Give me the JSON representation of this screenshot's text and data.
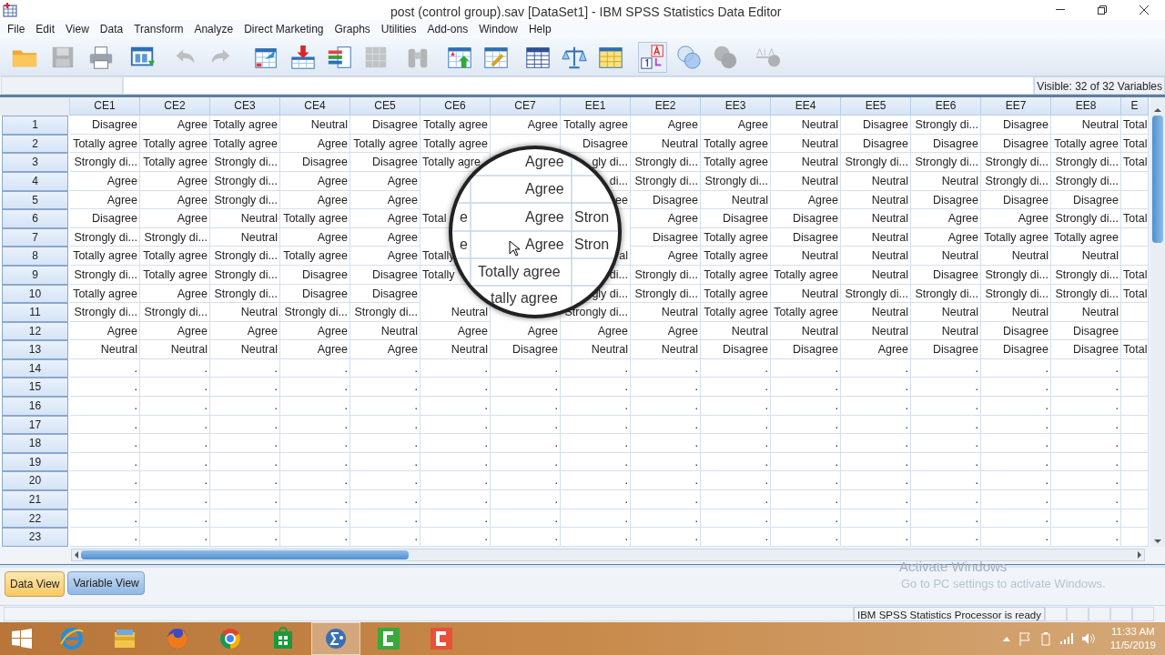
{
  "window": {
    "title": "post (control group).sav [DataSet1] - IBM SPSS Statistics Data Editor"
  },
  "menu": [
    "File",
    "Edit",
    "View",
    "Data",
    "Transform",
    "Analyze",
    "Direct Marketing",
    "Graphs",
    "Utilities",
    "Add-ons",
    "Window",
    "Help"
  ],
  "toolbar": [
    {
      "kind": "folder",
      "disabled": false
    },
    {
      "kind": "disk",
      "disabled": true
    },
    {
      "kind": "printer",
      "disabled": false
    },
    {
      "kind": "recall",
      "disabled": false
    },
    {
      "kind": "undo",
      "disabled": true
    },
    {
      "kind": "redo",
      "disabled": true
    },
    {
      "kind": "goto-case",
      "disabled": false
    },
    {
      "kind": "goto-variable",
      "disabled": false
    },
    {
      "kind": "variables",
      "disabled": false
    },
    {
      "kind": "stats",
      "disabled": true
    },
    {
      "kind": "binoculars",
      "disabled": true
    },
    {
      "kind": "insert-case",
      "disabled": false
    },
    {
      "kind": "insert-variable",
      "disabled": false
    },
    {
      "kind": "split",
      "disabled": false
    },
    {
      "kind": "scale",
      "disabled": false
    },
    {
      "kind": "select",
      "disabled": false
    },
    {
      "kind": "value-labels",
      "disabled": false
    },
    {
      "kind": "sets",
      "disabled": false
    },
    {
      "kind": "sets-all",
      "disabled": true
    },
    {
      "kind": "spell",
      "disabled": true
    }
  ],
  "visible_variables": "Visible: 32 of 32 Variables",
  "table": {
    "columns": [
      "CE1",
      "CE2",
      "CE3",
      "CE4",
      "CE5",
      "CE6",
      "CE7",
      "EE1",
      "EE2",
      "EE3",
      "EE4",
      "EE5",
      "EE6",
      "EE7",
      "EE8",
      "E"
    ],
    "rows": [
      {
        "number": "1",
        "cells": [
          "Disagree",
          "Agree",
          "Totally agree",
          "Neutral",
          "Disagree",
          "Totally agree",
          "Agree",
          "Totally agree",
          "Agree",
          "Agree",
          "Neutral",
          "Disagree",
          "Strongly di...",
          "Disagree",
          "Neutral",
          "Total"
        ]
      },
      {
        "number": "2",
        "cells": [
          "Totally agree",
          "Totally agree",
          "Totally agree",
          "Agree",
          "Totally agree",
          "Totally agree",
          null,
          "Disagree",
          "Neutral",
          "Totally agree",
          "Neutral",
          "Disagree",
          "Disagree",
          "Disagree",
          "Totally agree",
          "Total"
        ]
      },
      {
        "number": "3",
        "cells": [
          "Strongly di...",
          "Totally agree",
          "Strongly di...",
          "Disagree",
          "Disagree",
          {
            "text": "Totally agre",
            "cut": true
          },
          null,
          "gly di...",
          "Strongly di...",
          "Totally agree",
          "Neutral",
          "Strongly di...",
          "Strongly di...",
          "Strongly di...",
          "Strongly di...",
          "Total"
        ]
      },
      {
        "number": "4",
        "cells": [
          "Agree",
          "Agree",
          "Strongly di...",
          "Agree",
          "Agree",
          null,
          null,
          "di...",
          "Strongly di...",
          "Strongly di...",
          "Neutral",
          "Neutral",
          "Neutral",
          "Strongly di...",
          "Strongly di...",
          null
        ]
      },
      {
        "number": "5",
        "cells": [
          "Agree",
          "Agree",
          "Strongly di...",
          "Agree",
          "Agree",
          null,
          null,
          "ee",
          "Disagree",
          "Neutral",
          "Agree",
          "Neutral",
          "Disagree",
          "Disagree",
          "Disagree",
          null
        ]
      },
      {
        "number": "6",
        "cells": [
          "Disagree",
          "Agree",
          "Neutral",
          "Totally agree",
          "Agree",
          {
            "text": "Total",
            "cut": true
          },
          null,
          null,
          "Agree",
          "Disagree",
          "Disagree",
          "Neutral",
          "Agree",
          "Agree",
          "Strongly di...",
          "Total"
        ]
      },
      {
        "number": "7",
        "cells": [
          "Strongly di...",
          "Strongly di...",
          "Neutral",
          "Agree",
          "Agree",
          null,
          null,
          null,
          "Disagree",
          "Totally agree",
          "Disagree",
          "Neutral",
          "Agree",
          "Totally agree",
          "Totally agree",
          null
        ]
      },
      {
        "number": "8",
        "cells": [
          "Totally agree",
          "Totally agree",
          "Strongly di...",
          "Totally agree",
          "Agree",
          {
            "text": "Totally",
            "cut": true
          },
          null,
          "al",
          "Agree",
          "Totally agree",
          "Neutral",
          "Neutral",
          "Neutral",
          "Neutral",
          "Neutral",
          null
        ]
      },
      {
        "number": "9",
        "cells": [
          "Strongly di...",
          "Totally agree",
          "Strongly di...",
          "Disagree",
          "Disagree",
          {
            "text": "Totally",
            "cut": true
          },
          null,
          "di...",
          "Strongly di...",
          "Totally agree",
          "Totally agree",
          "Neutral",
          "Disagree",
          "Strongly di...",
          "Strongly di...",
          "Total"
        ]
      },
      {
        "number": "10",
        "cells": [
          "Totally agree",
          "Agree",
          "Strongly di...",
          "Disagree",
          "Disagree",
          null,
          null,
          "gly di...",
          "Strongly di...",
          "Totally agree",
          "Neutral",
          "Strongly di...",
          "Strongly di...",
          "Strongly di...",
          "Strongly di...",
          "Total"
        ]
      },
      {
        "number": "11",
        "cells": [
          "Strongly di...",
          "Strongly di...",
          "Neutral",
          "Strongly di...",
          "Strongly di...",
          "Neutral",
          null,
          "Strongly di...",
          "Neutral",
          "Totally agree",
          "Totally agree",
          "Neutral",
          "Neutral",
          "Neutral",
          "Neutral",
          null
        ]
      },
      {
        "number": "12",
        "cells": [
          "Agree",
          "Agree",
          "Agree",
          "Agree",
          "Neutral",
          "Agree",
          "Agree",
          "Agree",
          "Agree",
          "Neutral",
          "Neutral",
          "Neutral",
          "Neutral",
          "Disagree",
          "Disagree",
          null
        ]
      },
      {
        "number": "13",
        "cells": [
          "Neutral",
          "Neutral",
          "Neutral",
          "Agree",
          "Agree",
          "Neutral",
          "Disagree",
          "Neutral",
          "Neutral",
          "Disagree",
          "Disagree",
          "Agree",
          "Disagree",
          "Disagree",
          "Disagree",
          "Total"
        ]
      },
      {
        "number": "14",
        "cells": [
          ".",
          ".",
          ".",
          ".",
          ".",
          ".",
          ".",
          ".",
          ".",
          ".",
          ".",
          ".",
          ".",
          ".",
          ".",
          null
        ]
      },
      {
        "number": "15",
        "cells": [
          ".",
          ".",
          ".",
          ".",
          ".",
          ".",
          ".",
          ".",
          ".",
          ".",
          ".",
          ".",
          ".",
          ".",
          ".",
          null
        ]
      },
      {
        "number": "16",
        "cells": [
          ".",
          ".",
          ".",
          ".",
          ".",
          ".",
          ".",
          ".",
          ".",
          ".",
          ".",
          ".",
          ".",
          ".",
          ".",
          null
        ]
      },
      {
        "number": "17",
        "cells": [
          ".",
          ".",
          ".",
          ".",
          ".",
          ".",
          ".",
          ".",
          ".",
          ".",
          ".",
          ".",
          ".",
          ".",
          ".",
          null
        ]
      },
      {
        "number": "18",
        "cells": [
          ".",
          ".",
          ".",
          ".",
          ".",
          ".",
          ".",
          ".",
          ".",
          ".",
          ".",
          ".",
          ".",
          ".",
          ".",
          null
        ]
      },
      {
        "number": "19",
        "cells": [
          ".",
          ".",
          ".",
          ".",
          ".",
          ".",
          ".",
          ".",
          ".",
          ".",
          ".",
          ".",
          ".",
          ".",
          ".",
          null
        ]
      },
      {
        "number": "20",
        "cells": [
          ".",
          ".",
          ".",
          ".",
          ".",
          ".",
          ".",
          ".",
          ".",
          ".",
          ".",
          ".",
          ".",
          ".",
          ".",
          null
        ]
      },
      {
        "number": "21",
        "cells": [
          ".",
          ".",
          ".",
          ".",
          ".",
          ".",
          ".",
          ".",
          ".",
          ".",
          ".",
          ".",
          ".",
          ".",
          ".",
          null
        ]
      },
      {
        "number": "22",
        "cells": [
          ".",
          ".",
          ".",
          ".",
          ".",
          ".",
          ".",
          ".",
          ".",
          ".",
          ".",
          ".",
          ".",
          ".",
          ".",
          null
        ]
      },
      {
        "number": "23",
        "cells": [
          ".",
          ".",
          ".",
          ".",
          ".",
          ".",
          ".",
          ".",
          ".",
          ".",
          ".",
          ".",
          ".",
          ".",
          ".",
          null
        ]
      }
    ]
  },
  "magnifier": {
    "labels": [
      "Agree",
      "Agree",
      "e",
      "Agree",
      "Stron",
      "e",
      "Agree",
      "Stron",
      "Totally agree",
      "tally agree"
    ]
  },
  "tabs": [
    {
      "label": "Data View",
      "selected": true
    },
    {
      "label": "Variable View",
      "selected": false
    }
  ],
  "activation": {
    "title": "Activate Windows",
    "text": "Go to PC settings to activate Windows."
  },
  "status_bar": {
    "text": "IBM SPSS Statistics Processor is ready"
  },
  "taskbar": {
    "apps": [
      {
        "kind": "ie",
        "selected": false
      },
      {
        "kind": "explorer",
        "selected": false
      },
      {
        "kind": "firefox",
        "selected": false
      },
      {
        "kind": "chrome",
        "selected": false
      },
      {
        "kind": "store",
        "selected": false
      },
      {
        "kind": "spss",
        "selected": true
      },
      {
        "kind": "camtasia-green",
        "selected": false
      },
      {
        "kind": "camtasia-red",
        "selected": false
      }
    ],
    "time": "11:33 AM",
    "date": "11/5/2019"
  }
}
